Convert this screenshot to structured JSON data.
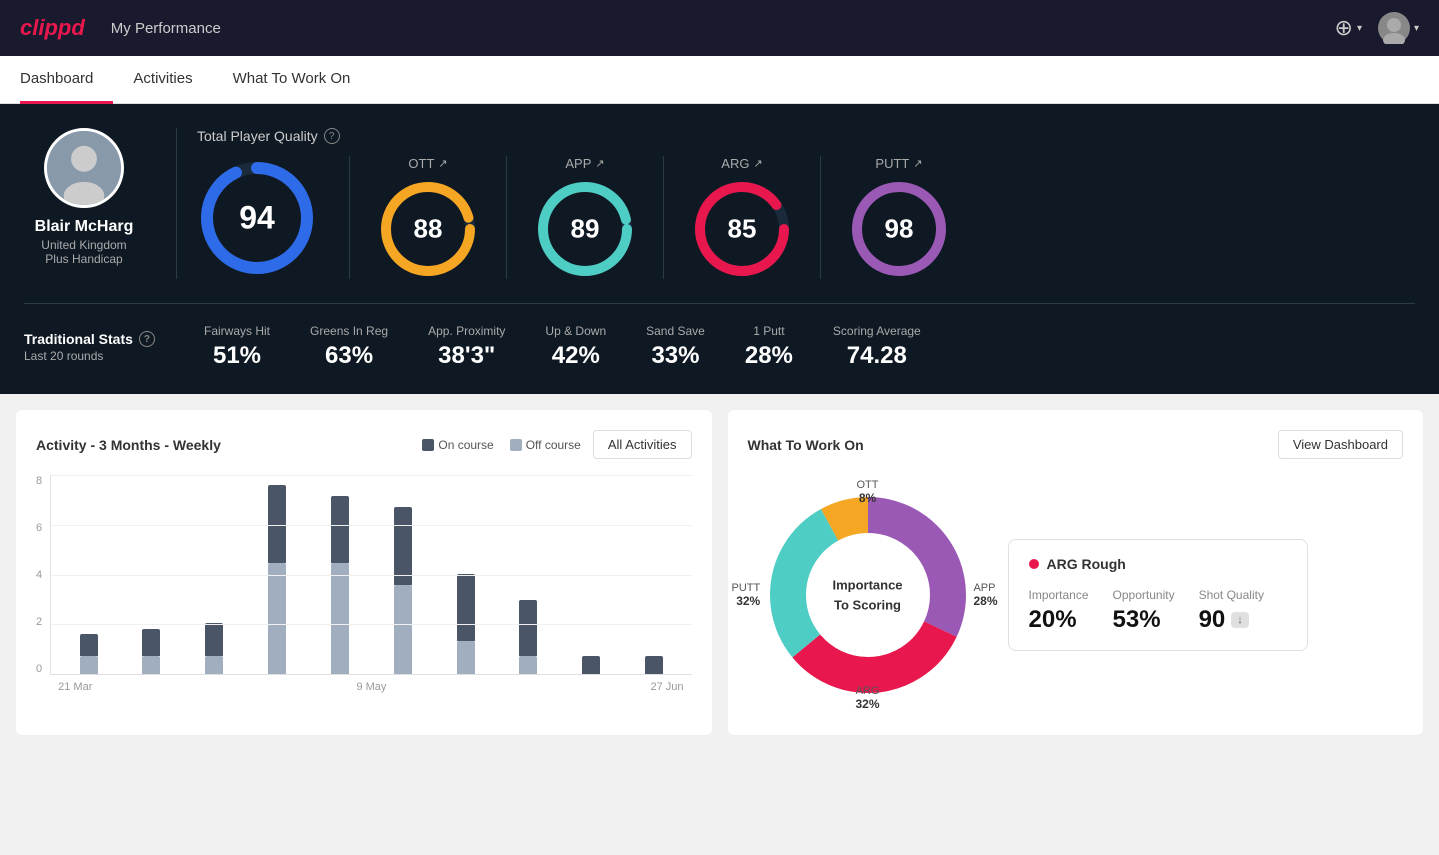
{
  "header": {
    "logo": "clippd",
    "title": "My Performance",
    "add_icon": "⊕",
    "avatar_icon": "👤"
  },
  "tabs": [
    {
      "label": "Dashboard",
      "active": true
    },
    {
      "label": "Activities",
      "active": false
    },
    {
      "label": "What To Work On",
      "active": false
    }
  ],
  "player": {
    "name": "Blair McHarg",
    "country": "United Kingdom",
    "handicap": "Plus Handicap"
  },
  "total_quality": {
    "label": "Total Player Quality",
    "value": 94,
    "color": "#2e6be8"
  },
  "scores": [
    {
      "label": "OTT",
      "value": 88,
      "color": "#f5a623"
    },
    {
      "label": "APP",
      "value": 89,
      "color": "#4ecdc4"
    },
    {
      "label": "ARG",
      "value": 85,
      "color": "#e8184e"
    },
    {
      "label": "PUTT",
      "value": 98,
      "color": "#9b59b6"
    }
  ],
  "traditional_stats": {
    "title": "Traditional Stats",
    "subtitle": "Last 20 rounds",
    "items": [
      {
        "label": "Fairways Hit",
        "value": "51%"
      },
      {
        "label": "Greens In Reg",
        "value": "63%"
      },
      {
        "label": "App. Proximity",
        "value": "38'3\""
      },
      {
        "label": "Up & Down",
        "value": "42%"
      },
      {
        "label": "Sand Save",
        "value": "33%"
      },
      {
        "label": "1 Putt",
        "value": "28%"
      },
      {
        "label": "Scoring Average",
        "value": "74.28"
      }
    ]
  },
  "activity_chart": {
    "title": "Activity - 3 Months - Weekly",
    "legend": {
      "on_course": "On course",
      "off_course": "Off course"
    },
    "button": "All Activities",
    "x_labels": [
      "21 Mar",
      "9 May",
      "27 Jun"
    ],
    "y_labels": [
      "8",
      "6",
      "4",
      "2",
      "0"
    ],
    "bars": [
      {
        "on": 1,
        "off": 0.8
      },
      {
        "on": 1.2,
        "off": 0.8
      },
      {
        "on": 1.5,
        "off": 0.8
      },
      {
        "on": 3.5,
        "off": 5
      },
      {
        "on": 3,
        "off": 5
      },
      {
        "on": 3.5,
        "off": 4
      },
      {
        "on": 3,
        "off": 1.5
      },
      {
        "on": 2.5,
        "off": 0.8
      },
      {
        "on": 0.8,
        "off": 0
      },
      {
        "on": 0.8,
        "off": 0
      }
    ]
  },
  "what_to_work_on": {
    "title": "What To Work On",
    "button": "View Dashboard",
    "donut_center": "Importance\nTo Scoring",
    "segments": [
      {
        "label": "OTT",
        "pct": "8%",
        "color": "#f5a623"
      },
      {
        "label": "APP",
        "pct": "28%",
        "color": "#4ecdc4"
      },
      {
        "label": "ARG",
        "pct": "32%",
        "color": "#e8184e"
      },
      {
        "label": "PUTT",
        "pct": "32%",
        "color": "#9b59b6"
      }
    ],
    "work_card": {
      "title": "ARG Rough",
      "dot_color": "#e8184e",
      "metrics": [
        {
          "label": "Importance",
          "value": "20%"
        },
        {
          "label": "Opportunity",
          "value": "53%"
        },
        {
          "label": "Shot Quality",
          "value": "90",
          "badge": "↓"
        }
      ]
    }
  }
}
